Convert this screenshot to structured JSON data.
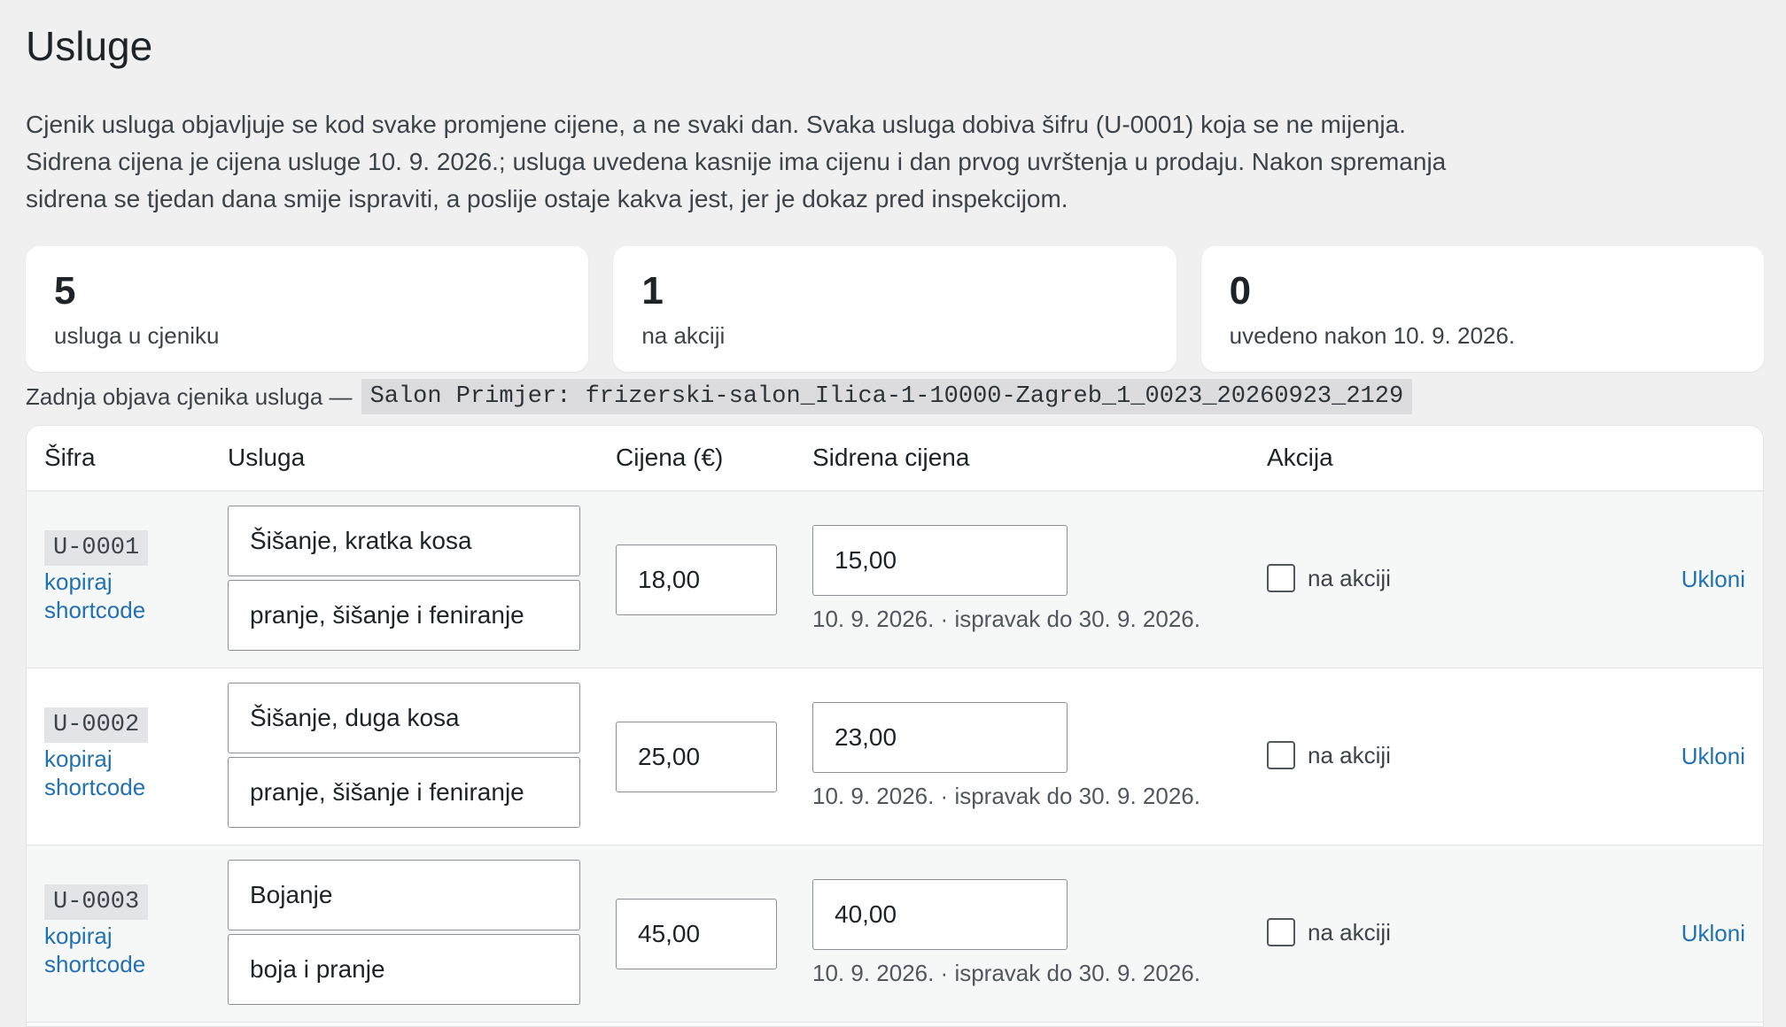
{
  "page": {
    "title": "Usluge",
    "intro_lines": [
      "Cjenik usluga objavljuje se kod svake promjene cijene, a ne svaki dan. Svaka usluga dobiva šifru (U-0001) koja se ne mijenja.",
      "Sidrena cijena je cijena usluge 10. 9. 2026.; usluga uvedena kasnije ima cijenu i dan prvog uvrštenja u prodaju. Nakon spremanja",
      "sidrena se tjedan dana smije ispraviti, a poslije ostaje kakva jest, jer je dokaz pred inspekcijom."
    ]
  },
  "stats": [
    {
      "value": "5",
      "label": "usluga u cjeniku"
    },
    {
      "value": "1",
      "label": "na akciji"
    },
    {
      "value": "0",
      "label": "uvedeno nakon 10. 9. 2026."
    }
  ],
  "last_publication": {
    "label": "Zadnja objava cjenika usluga —",
    "value": "Salon Primjer: frizerski-salon_Ilica-1-10000-Zagreb_1_0023_20260923_2129"
  },
  "table": {
    "headers": {
      "code": "Šifra",
      "service": "Usluga",
      "price": "Cijena (€)",
      "anchor": "Sidrena cijena",
      "promo": "Akcija"
    },
    "rows": [
      {
        "code": "U-0001",
        "copy_label": "kopiraj shortcode",
        "name": "Šišanje, kratka kosa",
        "description": "pranje, šišanje i feniranje",
        "price": "18,00",
        "anchor_price": "15,00",
        "anchor_note": "10. 9. 2026. · ispravak do 30. 9. 2026.",
        "promo_label": "na akciji",
        "promo_checked": false,
        "remove_label": "Ukloni"
      },
      {
        "code": "U-0002",
        "copy_label": "kopiraj shortcode",
        "name": "Šišanje, duga kosa",
        "description": "pranje, šišanje i feniranje",
        "price": "25,00",
        "anchor_price": "23,00",
        "anchor_note": "10. 9. 2026. · ispravak do 30. 9. 2026.",
        "promo_label": "na akciji",
        "promo_checked": false,
        "remove_label": "Ukloni"
      },
      {
        "code": "U-0003",
        "copy_label": "kopiraj shortcode",
        "name": "Bojanje",
        "description": "boja i pranje",
        "price": "45,00",
        "anchor_price": "40,00",
        "anchor_note": "10. 9. 2026. · ispravak do 30. 9. 2026.",
        "promo_label": "na akciji",
        "promo_checked": false,
        "remove_label": "Ukloni"
      }
    ]
  },
  "colors": {
    "background": "#f0f0f1",
    "link": "#2271b1",
    "text": "#1d2327"
  }
}
